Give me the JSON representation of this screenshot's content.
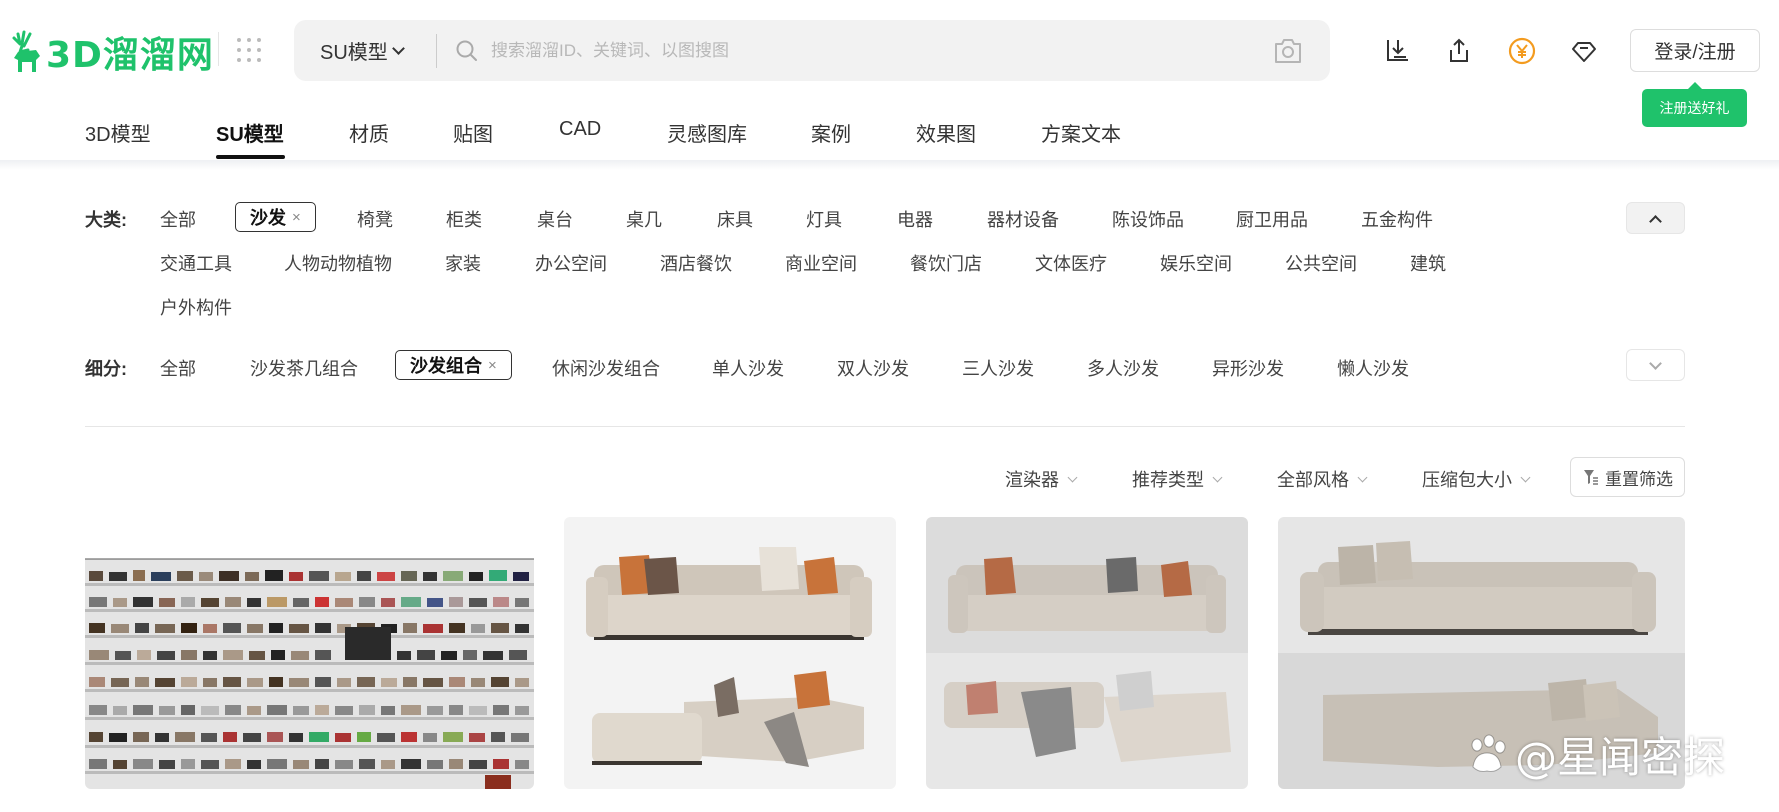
{
  "brand": {
    "logo_text": "3D溜溜网",
    "accent": "#1fc26b"
  },
  "search": {
    "category": "SU模型",
    "placeholder": "搜索溜溜ID、关键词、以图搜图"
  },
  "header_icons": [
    "download-icon",
    "upload-icon",
    "coin-icon",
    "diamond-icon"
  ],
  "login_label": "登录/注册",
  "promo_tip": "注册送好礼",
  "nav": {
    "items": [
      "3D模型",
      "SU模型",
      "材质",
      "贴图",
      "CAD",
      "灵感图库",
      "案例",
      "效果图",
      "方案文本"
    ],
    "active": "SU模型"
  },
  "filters": {
    "category": {
      "label": "大类:",
      "row1": [
        "全部",
        "沙发",
        "椅凳",
        "柜类",
        "桌台",
        "桌几",
        "床具",
        "灯具",
        "电器",
        "器材设备",
        "陈设饰品",
        "厨卫用品",
        "五金构件"
      ],
      "row2": [
        "交通工具",
        "人物动物植物",
        "家装",
        "办公空间",
        "酒店餐饮",
        "商业空间",
        "餐饮门店",
        "文体医疗",
        "娱乐空间",
        "公共空间",
        "建筑"
      ],
      "row3": [
        "户外构件"
      ],
      "selected": "沙发"
    },
    "subcategory": {
      "label": "细分:",
      "items": [
        "全部",
        "沙发茶几组合",
        "沙发组合",
        "休闲沙发组合",
        "单人沙发",
        "双人沙发",
        "三人沙发",
        "多人沙发",
        "异形沙发",
        "懒人沙发"
      ],
      "selected": "沙发组合"
    },
    "chip_close": "×"
  },
  "sort": {
    "options": [
      "渲染器",
      "推荐类型",
      "全部风格",
      "压缩包大小"
    ],
    "reset_label": "重置筛选"
  },
  "results": [
    {
      "name": "sofa-collection-library"
    },
    {
      "name": "beige-sofa-set-orange-pillows"
    },
    {
      "name": "modular-sofa-checkered-throw"
    },
    {
      "name": "grey-fabric-sectional-sofa"
    }
  ],
  "watermark": "@星闻密探"
}
